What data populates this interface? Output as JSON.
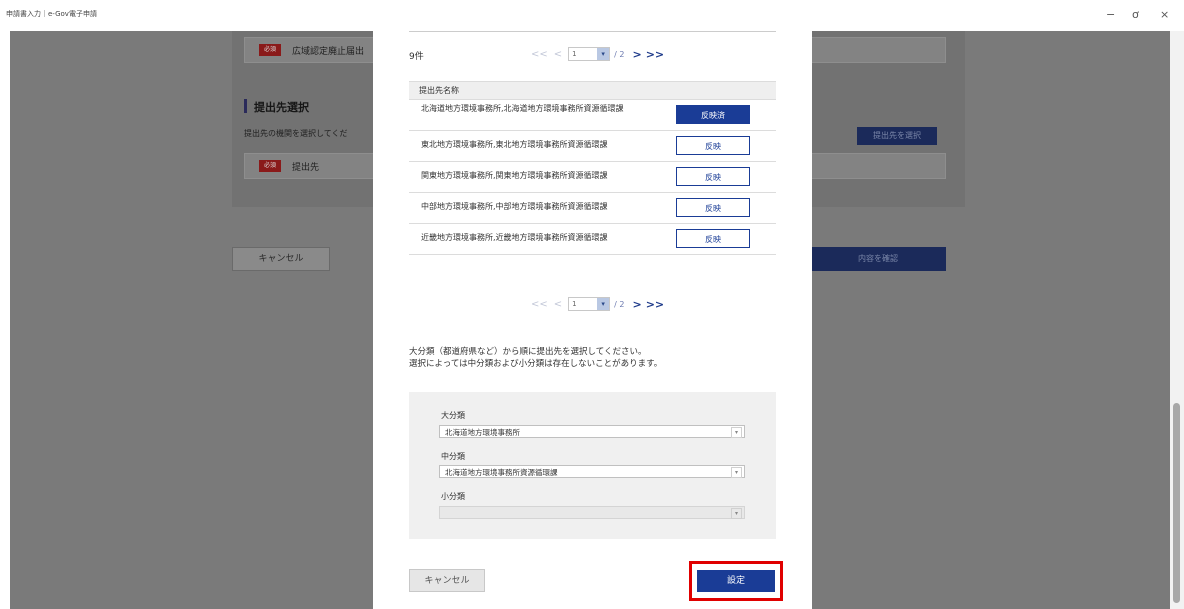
{
  "window": {
    "title": "申請書入力｜e-Gov電子申請",
    "min": "−",
    "restore": "ơ",
    "close": "×"
  },
  "background": {
    "required_badge": "必須",
    "field1_label": "広域認定廃止届出",
    "section_heading": "提出先選択",
    "section_desc": "提出先の機関を選択してくだ",
    "select_dest_button": "提出先を選択",
    "dest_label": "提出先",
    "cancel_button": "キャンセル",
    "confirm_button": "内容を確認"
  },
  "modal": {
    "count": "9件",
    "pager": {
      "first": "<<",
      "prev": "<",
      "page": "1",
      "dropdown": "▾",
      "total": "/ 2",
      "next": ">",
      "last": ">>"
    },
    "table": {
      "header": "提出先名称",
      "rows": [
        {
          "name": "北海道地方環境事務所,北海道地方環境事務所資源循環課",
          "button": "反映済"
        },
        {
          "name": "東北地方環境事務所,東北地方環境事務所資源循環課",
          "button": "反映"
        },
        {
          "name": "関東地方環境事務所,関東地方環境事務所資源循環課",
          "button": "反映"
        },
        {
          "name": "中部地方環境事務所,中部地方環境事務所資源循環課",
          "button": "反映"
        },
        {
          "name": "近畿地方環境事務所,近畿地方環境事務所資源循環課",
          "button": "反映"
        }
      ]
    },
    "instructions": {
      "line1": "大分類（都道府県など）から順に提出先を選択してください。",
      "line2": "選択によっては中分類および小分類は存在しないことがあります。"
    },
    "selects": {
      "major_label": "大分類",
      "major_value": "北海道地方環境事務所",
      "middle_label": "中分類",
      "middle_value": "北海道地方環境事務所資源循環課",
      "minor_label": "小分類",
      "minor_value": ""
    },
    "cancel_button": "キャンセル",
    "confirm_button": "設定"
  },
  "colors": {
    "accent": "#1a3c96",
    "highlight": "#e00000",
    "overlay": "#7a7a7a"
  }
}
